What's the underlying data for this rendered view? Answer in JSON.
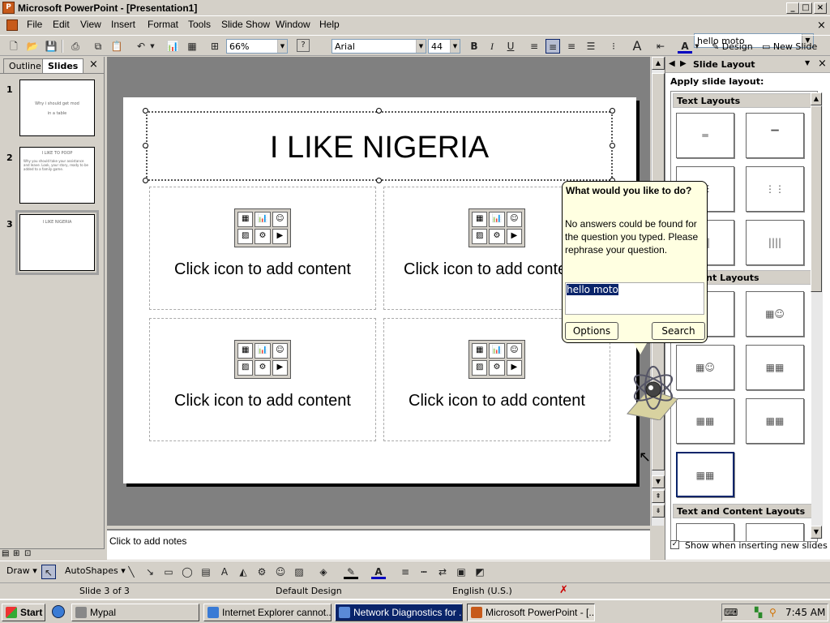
{
  "window": {
    "title": "Microsoft PowerPoint - [Presentation1]",
    "help_query": "hello moto"
  },
  "menus": [
    "File",
    "Edit",
    "View",
    "Insert",
    "Format",
    "Tools",
    "Slide Show",
    "Window",
    "Help"
  ],
  "toolbar": {
    "zoom": "66%",
    "font": "Arial",
    "font_size": "44",
    "bold": "B",
    "italic": "I",
    "underline": "U",
    "design_label": "Design",
    "new_slide_label": "New Slide"
  },
  "left_pane": {
    "tabs": [
      "Outline",
      "Slides"
    ],
    "slides": [
      {
        "num": "1",
        "title": "Why i should get mod",
        "subtitle": "in a table"
      },
      {
        "num": "2",
        "title": "I LIKE TO POOP",
        "subtitle": "Why you should take your assistance and leave. Look, your story, ready to be added to a family game."
      },
      {
        "num": "3",
        "title": "I LIKE NIGERIA",
        "subtitle": ""
      }
    ]
  },
  "slide": {
    "title": "I LIKE NIGERIA",
    "placeholders": [
      "Click icon to add content",
      "Click icon to add content",
      "Click icon to add content",
      "Click icon to add content"
    ]
  },
  "notes": {
    "placeholder": "Click to add notes"
  },
  "task_pane": {
    "title": "Slide Layout",
    "apply_label": "Apply slide layout:",
    "sections": [
      "Text Layouts",
      "Content Layouts",
      "Text and Content Layouts"
    ],
    "checkbox_label": "Show when inserting new slides"
  },
  "assistant_balloon": {
    "question": "What would you like to do?",
    "message": "No answers could be found for the question you typed. Please rephrase your question.",
    "input_value": "hello moto",
    "options_label": "Options",
    "search_label": "Search"
  },
  "drawing_toolbar": {
    "draw_label": "Draw",
    "autoshapes_label": "AutoShapes"
  },
  "status_bar": {
    "slide": "Slide 3 of 3",
    "design": "Default Design",
    "language": "English (U.S.)"
  },
  "taskbar": {
    "start_label": "Start",
    "items": [
      "Mypal",
      "Internet Explorer cannot...",
      "Network Diagnostics for ...",
      "Microsoft PowerPoint - [..."
    ],
    "clock": "7:45 AM"
  }
}
